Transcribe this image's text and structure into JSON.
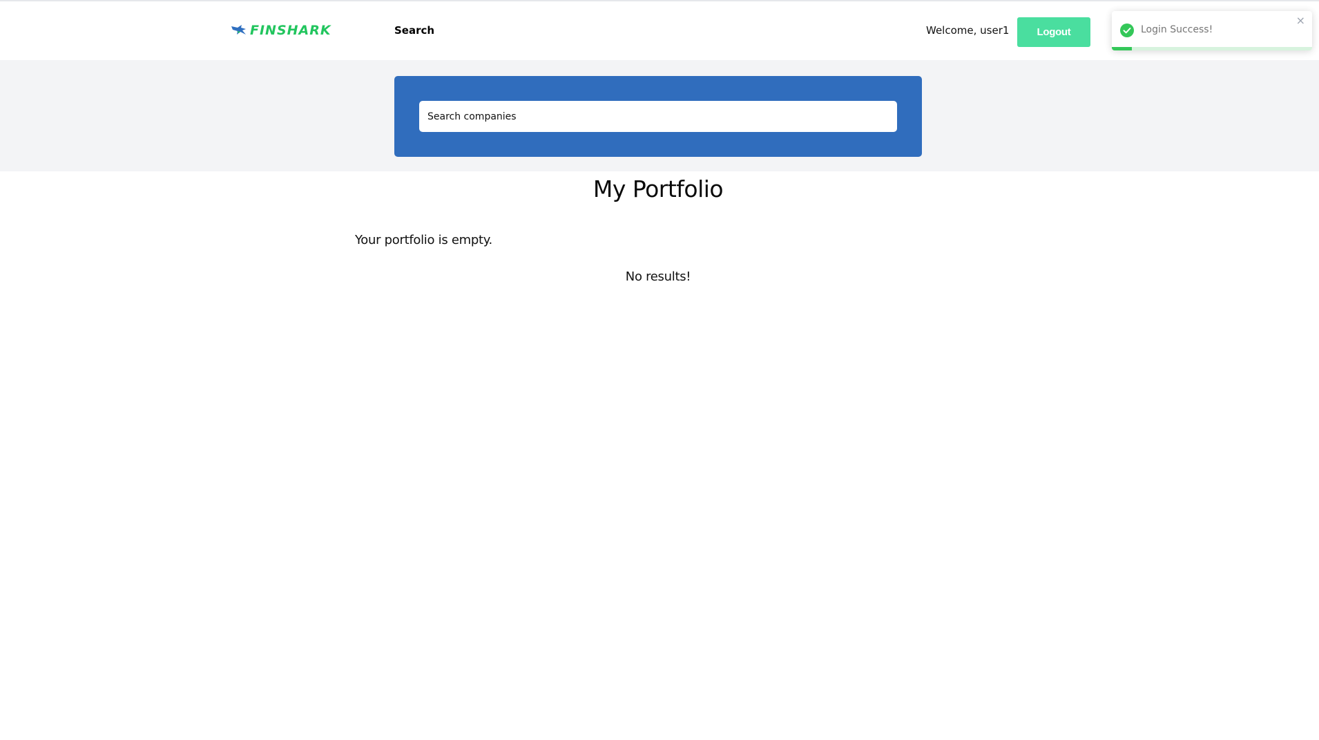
{
  "app": {
    "brand": "FINSHARK",
    "colors": {
      "brand_green": "#22c55e",
      "brand_blue": "#306dbd",
      "logout_bg": "#4ade9f",
      "toast_success": "#34c759"
    }
  },
  "navbar": {
    "logo_icon": "shark-logo-icon",
    "search_link": "Search",
    "welcome_text": "Welcome, user1",
    "logout_label": "Logout"
  },
  "toast": {
    "message": "Login Success!",
    "icon": "check-circle-icon",
    "close_icon": "close-icon",
    "close_glyph": "×",
    "progress": 0.1
  },
  "search": {
    "placeholder": "Search companies",
    "value": ""
  },
  "main": {
    "title": "My Portfolio",
    "portfolio_empty": "Your portfolio is empty.",
    "no_results": "No results!"
  }
}
